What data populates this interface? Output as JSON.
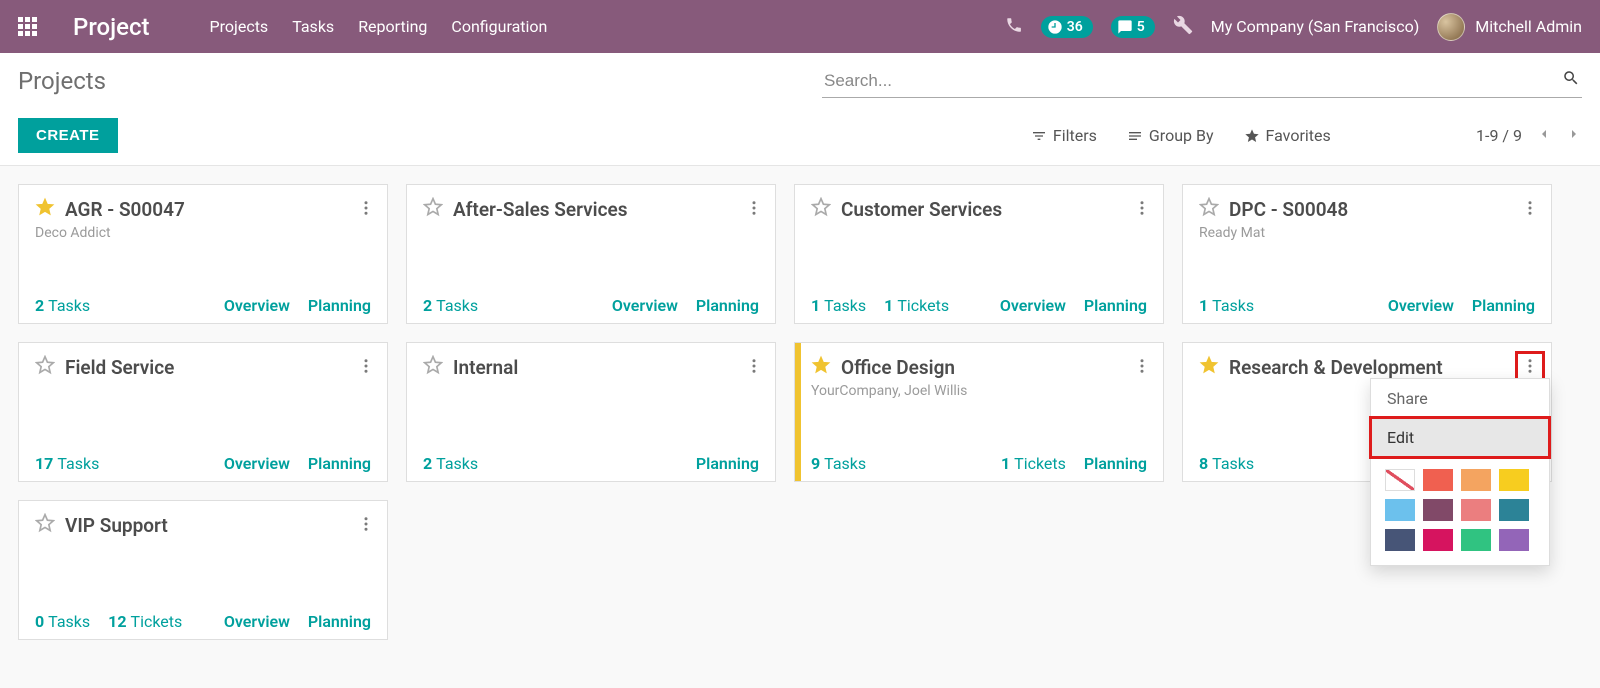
{
  "nav": {
    "brand": "Project",
    "items": [
      "Projects",
      "Tasks",
      "Reporting",
      "Configuration"
    ],
    "timer_count": "36",
    "msg_count": "5",
    "company": "My Company (San Francisco)",
    "user": "Mitchell Admin"
  },
  "cp": {
    "title": "Projects",
    "create": "CREATE",
    "search_placeholder": "Search...",
    "filters": "Filters",
    "groupby": "Group By",
    "favorites": "Favorites",
    "pager": "1-9 / 9"
  },
  "cards": [
    {
      "title": "AGR - S00047",
      "subtitle": "Deco Addict",
      "fav": true,
      "links": [
        [
          "2",
          "Tasks"
        ],
        [
          "",
          "Overview"
        ],
        [
          "",
          "Planning"
        ]
      ]
    },
    {
      "title": "After-Sales Services",
      "subtitle": "",
      "fav": false,
      "links": [
        [
          "2",
          "Tasks"
        ],
        [
          "",
          "Overview"
        ],
        [
          "",
          "Planning"
        ]
      ]
    },
    {
      "title": "Customer Services",
      "subtitle": "",
      "fav": false,
      "links": [
        [
          "1",
          "Tasks"
        ],
        [
          "1",
          "Tickets"
        ],
        [
          "",
          "Overview"
        ],
        [
          "",
          "Planning"
        ]
      ]
    },
    {
      "title": "DPC - S00048",
      "subtitle": "Ready Mat",
      "fav": false,
      "links": [
        [
          "1",
          "Tasks"
        ],
        [
          "",
          "Overview"
        ],
        [
          "",
          "Planning"
        ]
      ]
    },
    {
      "title": "Field Service",
      "subtitle": "",
      "fav": false,
      "links": [
        [
          "17",
          "Tasks"
        ],
        [
          "",
          "Overview"
        ],
        [
          "",
          "Planning"
        ]
      ]
    },
    {
      "title": "Internal",
      "subtitle": "",
      "fav": false,
      "links": [
        [
          "2",
          "Tasks"
        ],
        [
          "",
          "Planning"
        ]
      ]
    },
    {
      "title": "Office Design",
      "subtitle": "YourCompany, Joel Willis",
      "fav": true,
      "bar": "#f0c330",
      "links": [
        [
          "9",
          "Tasks"
        ],
        [
          "1",
          "Tickets"
        ],
        [
          "",
          "Planning"
        ]
      ]
    },
    {
      "title": "Research & Development",
      "subtitle": "",
      "fav": true,
      "links": [
        [
          "8",
          "Tasks"
        ]
      ]
    },
    {
      "title": "VIP Support",
      "subtitle": "",
      "fav": false,
      "links": [
        [
          "0",
          "Tasks"
        ],
        [
          "12",
          "Tickets"
        ],
        [
          "",
          "Overview"
        ],
        [
          "",
          "Planning"
        ]
      ]
    }
  ],
  "dropdown": {
    "share": "Share",
    "edit": "Edit",
    "colors": [
      "none",
      "#F06050",
      "#F4A460",
      "#F7CD1F",
      "#6CC1ED",
      "#814968",
      "#EB7E7F",
      "#2C8397",
      "#475577",
      "#D6145F",
      "#30C381",
      "#9365B8"
    ]
  }
}
